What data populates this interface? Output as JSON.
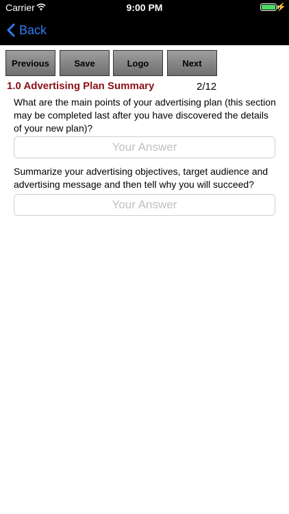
{
  "status_bar": {
    "carrier": "Carrier",
    "time": "9:00 PM",
    "battery_color": "#4cd964"
  },
  "nav": {
    "back_label": "Back",
    "accent_color": "#2f7cf6"
  },
  "toolbar": {
    "previous_label": "Previous",
    "save_label": "Save",
    "logo_label": "Logo",
    "next_label": "Next"
  },
  "section": {
    "title": "1.0 Advertising Plan Summary",
    "counter": "2/12",
    "title_color": "#8b0f16"
  },
  "questions": [
    {
      "text": "What are the main points of your advertising plan (this section may be completed last after you have discovered the details of your new plan)?",
      "value": "",
      "placeholder": "Your Answer"
    },
    {
      "text": "Summarize your advertising objectives, target audience and advertising message and then tell why you will succeed?",
      "value": "",
      "placeholder": "Your Answer"
    }
  ]
}
